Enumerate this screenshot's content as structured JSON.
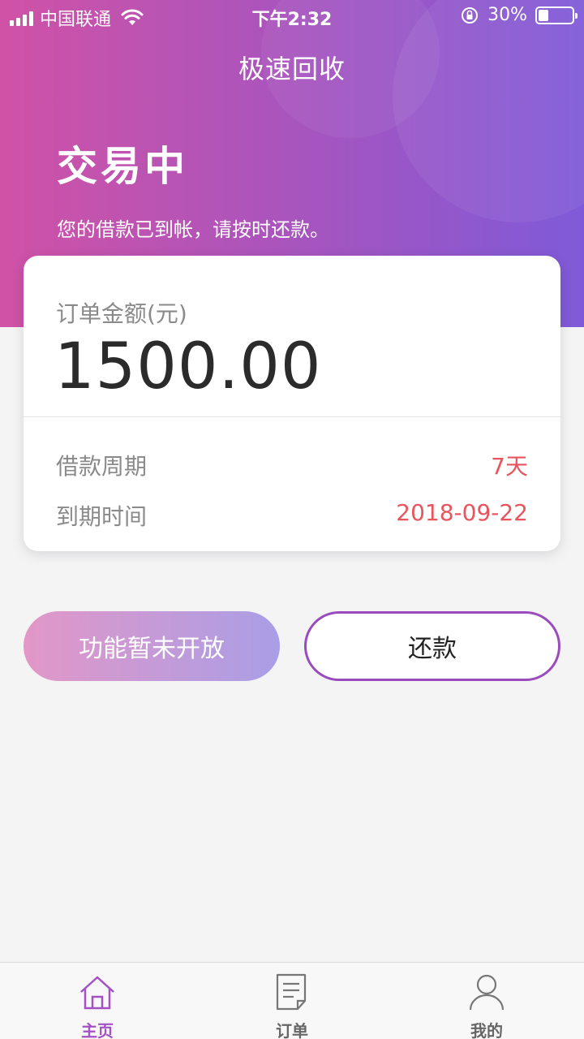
{
  "status_bar": {
    "carrier": "中国联通",
    "time": "下午2:32",
    "battery": "30%",
    "battery_level": 0.3
  },
  "header": {
    "title": "极速回收",
    "status": "交易中",
    "message": "您的借款已到帐，请按时还款。"
  },
  "order_card": {
    "amount_label": "订单金额(元)",
    "amount": "1500.00",
    "details": [
      {
        "label": "借款周期",
        "value": "7天"
      },
      {
        "label": "到期时间",
        "value": "2018-09-22"
      }
    ]
  },
  "actions": {
    "disabled_label": "功能暂未开放",
    "repay_label": "还款"
  },
  "tab_bar": {
    "items": [
      {
        "label": "主页",
        "icon": "home-icon",
        "active": true
      },
      {
        "label": "订单",
        "icon": "document-icon",
        "active": false
      },
      {
        "label": "我的",
        "icon": "user-icon",
        "active": false
      }
    ]
  },
  "colors": {
    "gradient_start": "#d052a6",
    "gradient_end": "#7f5ad8",
    "accent": "#a451c4",
    "highlight_value": "#e8555c"
  }
}
